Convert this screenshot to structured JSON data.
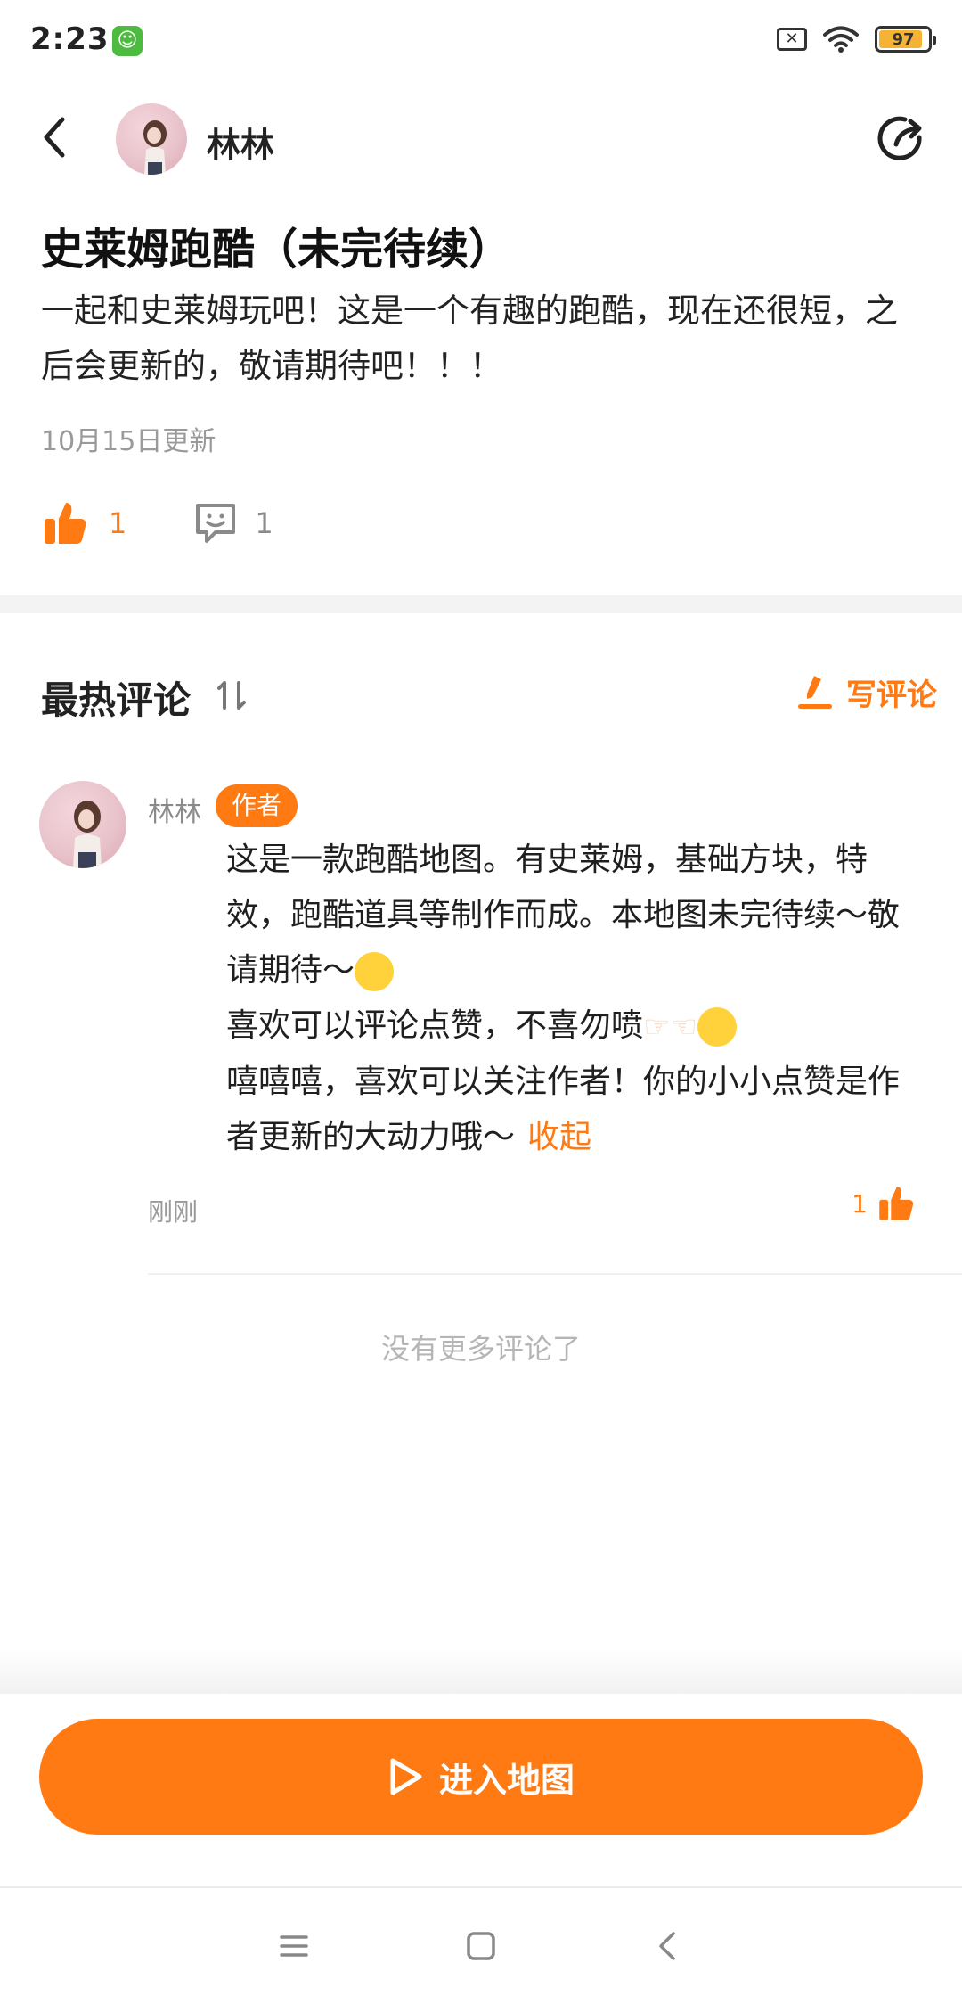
{
  "status_bar": {
    "time": "2:23",
    "battery": "97"
  },
  "header": {
    "name": "林林"
  },
  "post": {
    "title": "史莱姆跑酷（未完待续）",
    "description": "一起和史莱姆玩吧！这是一个有趣的跑酷，现在还很短，之后会更新的，敬请期待吧！！！",
    "updated": "10月15日更新",
    "like_count": "1",
    "comment_count": "1"
  },
  "comments_section": {
    "title": "最热评论",
    "write_label": "写评论",
    "no_more": "没有更多评论了"
  },
  "comment": {
    "name": "林林",
    "badge": "作者",
    "para1": "这是一款跑酷地图。有史莱姆，基础方块，特效，跑酷道具等制作而成。本地图未完待续～敬请期待～",
    "para2": "喜欢可以评论点赞，不喜勿喷",
    "para3": "嘻嘻嘻，喜欢可以关注作者！你的小小点赞是作者更新的大动力哦～",
    "collapse": "收起",
    "time": "刚刚",
    "like_count": "1"
  },
  "enter_button": {
    "label": "进入地图"
  },
  "colors": {
    "accent": "#ff7a12",
    "band": "#f3f3f3"
  }
}
